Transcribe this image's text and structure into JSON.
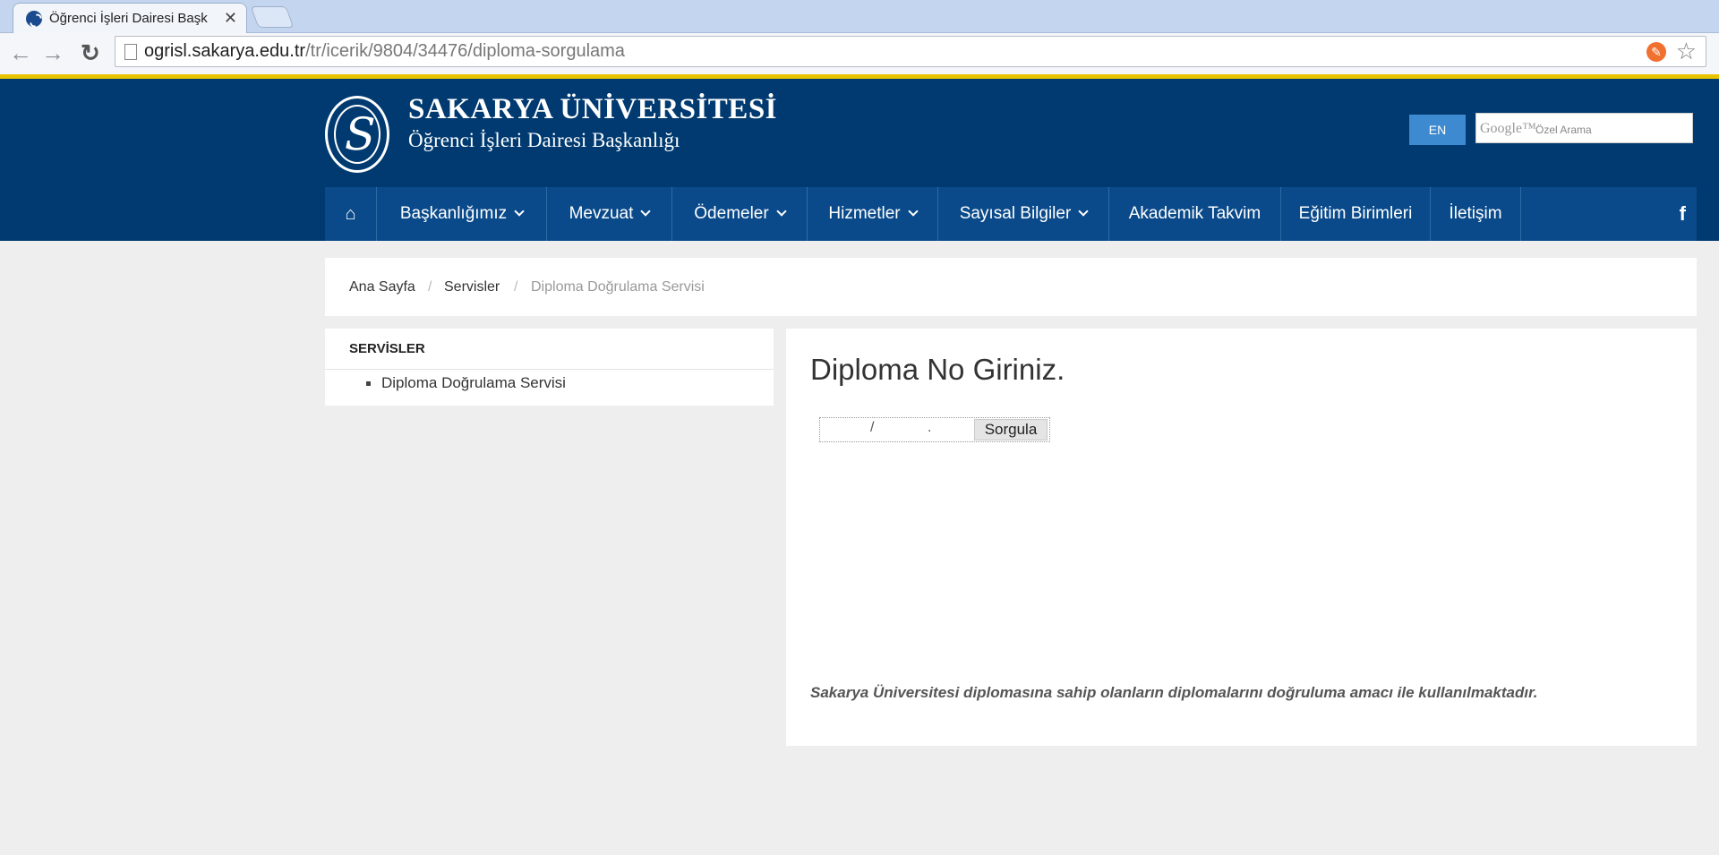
{
  "browser": {
    "tab_title": "Öğrenci İşleri Dairesi Başk",
    "tab_close": "✕",
    "url_host": "ogrisl.sakarya.edu.tr",
    "url_path": "/tr/icerik/9804/34476/diploma-sorgulama"
  },
  "header": {
    "title": "SAKARYA ÜNİVERSİTESİ",
    "subtitle": "Öğrenci İşleri Dairesi Başkanlığı",
    "lang_button": "EN",
    "search_brand": "Google™",
    "search_placeholder": "Özel Arama"
  },
  "menu": {
    "items": [
      {
        "label": "Başkanlığımız"
      },
      {
        "label": "Mevzuat"
      },
      {
        "label": "Ödemeler"
      },
      {
        "label": "Hizmetler"
      },
      {
        "label": "Sayısal Bilgiler"
      },
      {
        "label": "Akademik Takvim"
      },
      {
        "label": "Eğitim Birimleri"
      },
      {
        "label": "İletişim"
      }
    ],
    "facebook": "f"
  },
  "breadcrumb": {
    "items": [
      "Ana Sayfa",
      "Servisler",
      "Diploma Doğrulama Servisi"
    ],
    "separator": "/"
  },
  "sidebar": {
    "title": "SERVİSLER",
    "items": [
      {
        "label": "Diploma Doğrulama Servisi"
      }
    ]
  },
  "content": {
    "title": "Diploma No Giriniz.",
    "form": {
      "sep1": "/",
      "sep2": ".",
      "button_label": "Sorgula"
    },
    "note": "Sakarya Üniversitesi diplomasına sahip olanların diplomalarını doğruluma amacı ile kullanılmaktadır."
  },
  "colors": {
    "header_bg": "#003a70",
    "menu_bg": "#0a4a8a",
    "accent_bar": "#e7c300",
    "lang_button": "#3e8ad0"
  }
}
